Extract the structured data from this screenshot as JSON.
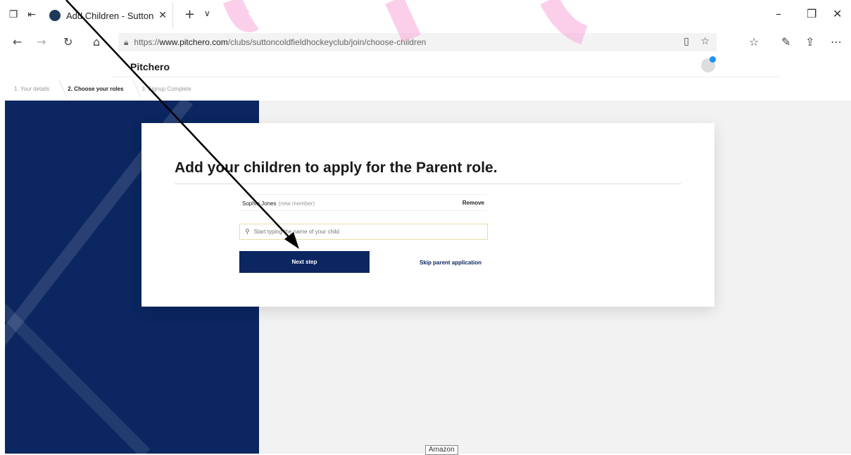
{
  "browser": {
    "tab_title": "Add Children - Sutton C",
    "url_prefix": "https://",
    "url_host": "www.pitchero.com",
    "url_path": "/clubs/suttoncoldfieldhockeyclub/join/choose-children"
  },
  "site": {
    "logo": "Pitchero",
    "steps": [
      "1. Your details",
      "2. Choose your roles",
      "3. Signup Complete"
    ],
    "active_step": 1
  },
  "card": {
    "title": "Add your children to apply for the Parent role.",
    "child": {
      "name": "Sophie Jones",
      "tag": "(new member)",
      "remove_label": "Remove"
    },
    "search_placeholder": "Start typing the name of your child",
    "next_label": "Next step",
    "skip_label": "Skip parent application"
  },
  "tooltip": "Amazon",
  "colors": {
    "brand_navy": "#0b2660",
    "annotation_pink": "#f7a8d8"
  }
}
